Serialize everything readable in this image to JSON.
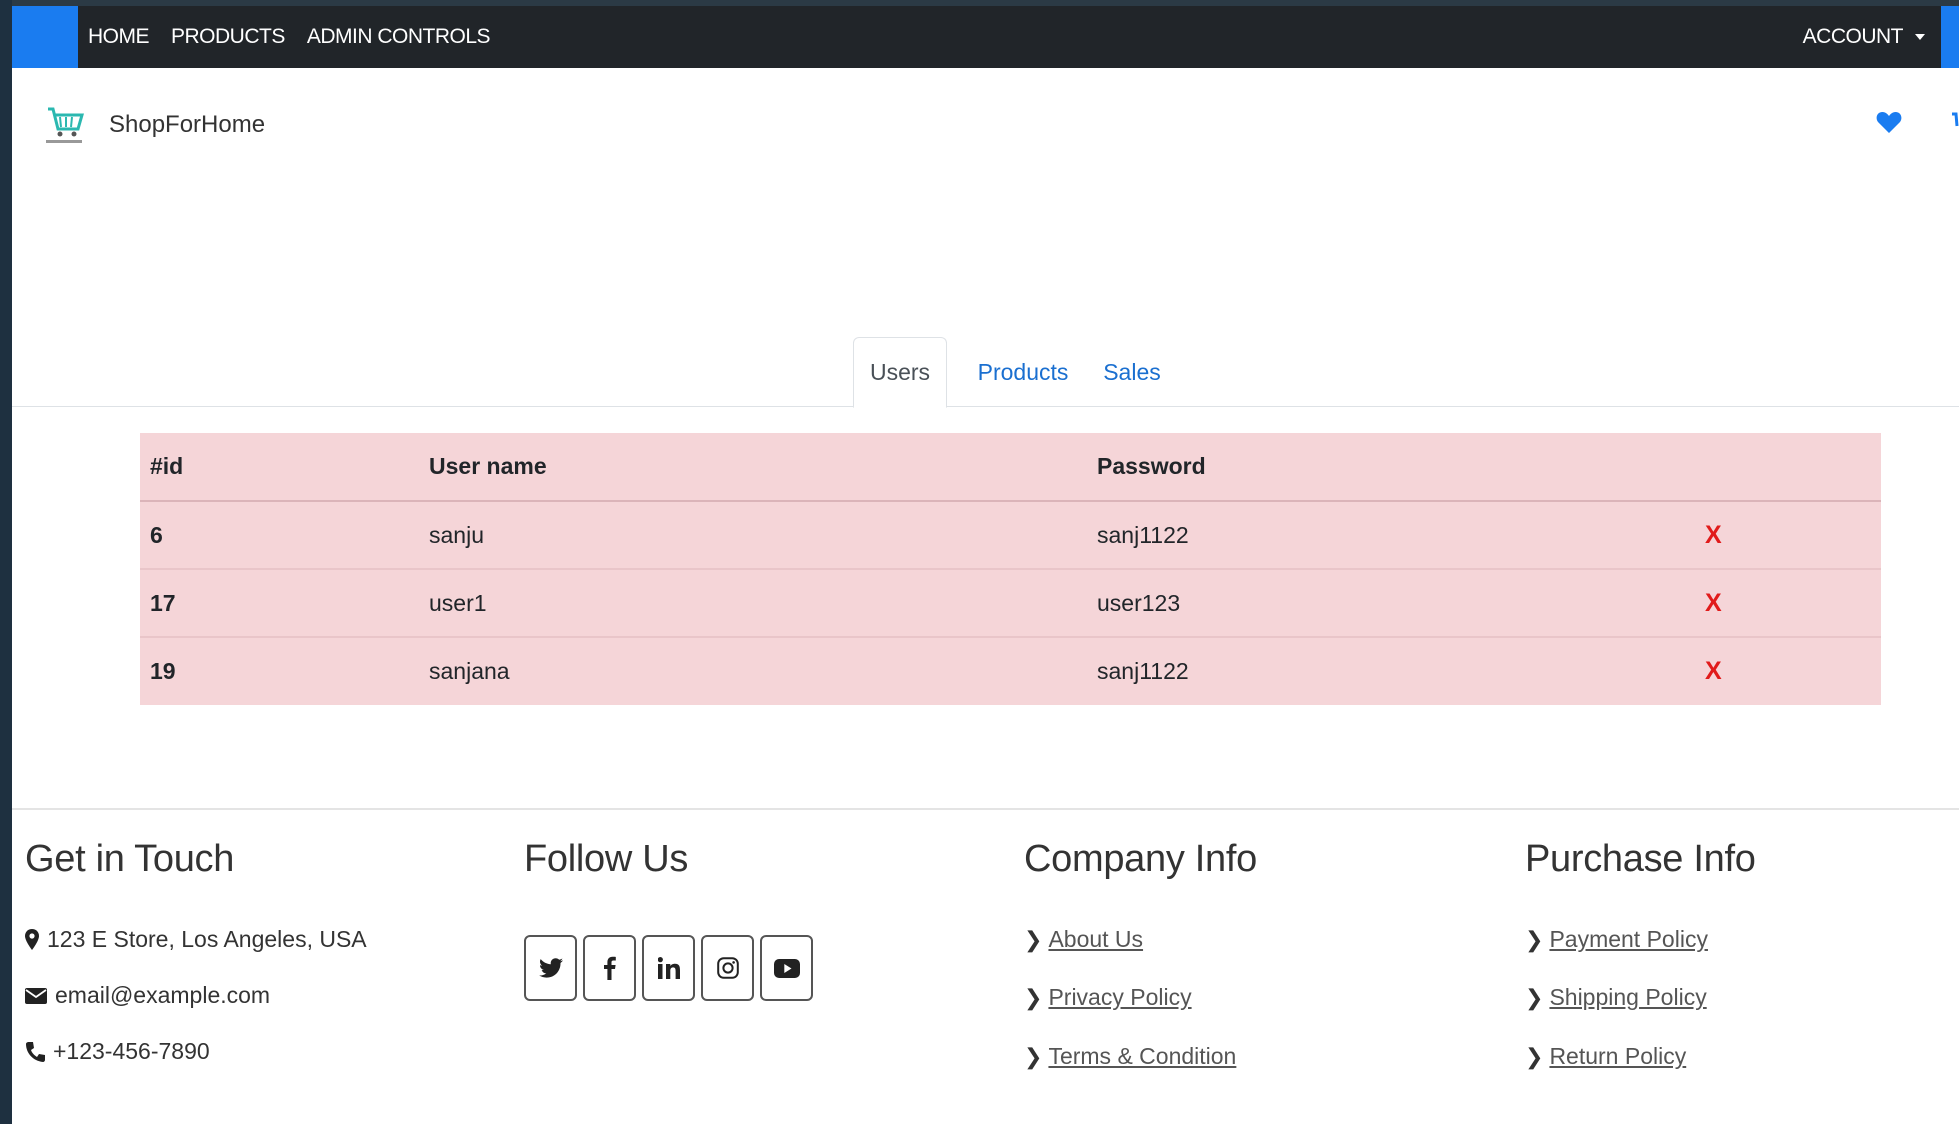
{
  "navbar": {
    "links": [
      "HOME",
      "PRODUCTS",
      "ADMIN CONTROLS"
    ],
    "account_label": "ACCOUNT"
  },
  "brand": {
    "name": "ShopForHome"
  },
  "tabs": [
    {
      "label": "Users",
      "active": true
    },
    {
      "label": "Products",
      "active": false
    },
    {
      "label": "Sales",
      "active": false
    }
  ],
  "table": {
    "headers": [
      "#id",
      "User name",
      "Password",
      ""
    ],
    "rows": [
      {
        "id": "6",
        "username": "sanju",
        "password": "sanj1122",
        "action": "X"
      },
      {
        "id": "17",
        "username": "user1",
        "password": "user123",
        "action": "X"
      },
      {
        "id": "19",
        "username": "sanjana",
        "password": "sanj1122",
        "action": "X"
      }
    ]
  },
  "footer": {
    "contact": {
      "title": "Get in Touch",
      "address": "123 E Store, Los Angeles, USA",
      "email": "email@example.com",
      "phone": "+123-456-7890"
    },
    "follow": {
      "title": "Follow Us",
      "icons": [
        "twitter-icon",
        "facebook-icon",
        "linkedin-icon",
        "instagram-icon",
        "youtube-icon"
      ]
    },
    "company": {
      "title": "Company Info",
      "links": [
        "About Us",
        "Privacy Policy",
        "Terms & Condition"
      ]
    },
    "purchase": {
      "title": "Purchase Info",
      "links": [
        "Payment Policy",
        "Shipping Policy",
        "Return Policy"
      ]
    }
  },
  "colors": {
    "navbar_bg": "#212529",
    "accent_blue": "#1a7cf0",
    "table_bg": "#f5d5d8",
    "delete_red": "#e11b1b",
    "tab_link": "#1a6fd0"
  }
}
